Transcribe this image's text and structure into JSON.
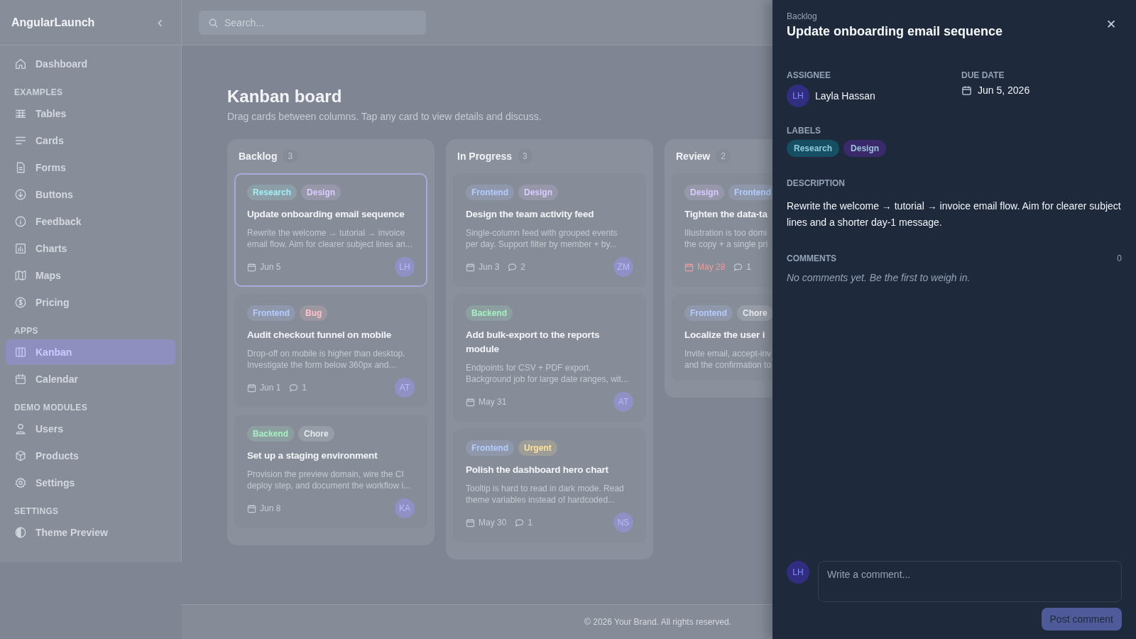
{
  "sidebar": {
    "brand": "AngularLaunch",
    "collapse_icon": "‹",
    "items": [
      {
        "kind": "link",
        "label": "Dashboard",
        "selected": false
      },
      {
        "kind": "section",
        "label": "EXAMPLES"
      },
      {
        "kind": "link",
        "label": "Tables",
        "selected": false
      },
      {
        "kind": "link",
        "label": "Cards",
        "selected": false
      },
      {
        "kind": "link",
        "label": "Forms",
        "selected": false
      },
      {
        "kind": "link",
        "label": "Buttons",
        "selected": false
      },
      {
        "kind": "link",
        "label": "Feedback",
        "selected": false
      },
      {
        "kind": "link",
        "label": "Charts",
        "selected": false
      },
      {
        "kind": "link",
        "label": "Maps",
        "selected": false
      },
      {
        "kind": "link",
        "label": "Pricing",
        "selected": false
      },
      {
        "kind": "section",
        "label": "APPS"
      },
      {
        "kind": "link",
        "label": "Kanban",
        "selected": true
      },
      {
        "kind": "link",
        "label": "Calendar",
        "selected": false
      },
      {
        "kind": "section",
        "label": "DEMO MODULES"
      },
      {
        "kind": "link",
        "label": "Users",
        "selected": false
      },
      {
        "kind": "link",
        "label": "Products",
        "selected": false
      },
      {
        "kind": "link",
        "label": "Settings",
        "selected": false
      },
      {
        "kind": "section",
        "label": "SETTINGS"
      },
      {
        "kind": "link",
        "label": "Theme Preview",
        "selected": false
      }
    ]
  },
  "search": {
    "placeholder": "Search..."
  },
  "page": {
    "title": "Kanban board",
    "subtitle": "Drag cards between columns. Tap any card to view details and discuss."
  },
  "columns": [
    {
      "title": "Backlog",
      "count": "3",
      "cards": [
        {
          "tags": [
            {
              "label": "Research",
              "color": "#a5eef5"
            },
            {
              "label": "Design",
              "color": "#dccbff"
            }
          ],
          "title": "Update onboarding email sequence",
          "desc_lines": [
            "Rewrite the welcome → tutorial → invoice",
            "email flow. Aim for clearer subject lines an..."
          ],
          "due": "Jun 5",
          "overdue": false,
          "assignee": "LH",
          "selected": true
        },
        {
          "tags": [
            {
              "label": "Frontend",
              "color": "#b6ccff"
            },
            {
              "label": "Bug",
              "color": "#ffc2cb"
            }
          ],
          "title": "Audit checkout funnel on mobile",
          "desc_lines": [
            "Drop-off on mobile is higher than desktop.",
            "Investigate the form below 360px and..."
          ],
          "due": "Jun 1",
          "overdue": false,
          "comments": "1",
          "assignee": "AT",
          "selected": false
        },
        {
          "tags": [
            {
              "label": "Backend",
              "color": "#a8f0c4"
            },
            {
              "label": "Chore",
              "color": "#e6e8ed"
            }
          ],
          "title": "Set up a staging environment",
          "desc_lines": [
            "Provision the preview domain, wire the CI",
            "deploy step, and document the workflow i..."
          ],
          "due": "Jun 8",
          "overdue": false,
          "assignee": "KA",
          "selected": false
        }
      ]
    },
    {
      "title": "In Progress",
      "count": "3",
      "cards": [
        {
          "tags": [
            {
              "label": "Frontend",
              "color": "#b6ccff"
            },
            {
              "label": "Design",
              "color": "#dccbff"
            }
          ],
          "title": "Design the team activity feed",
          "desc_lines": [
            "Single-column feed with grouped events",
            "per day. Support filter by member + by..."
          ],
          "due": "Jun 3",
          "overdue": false,
          "comments": "2",
          "assignee": "ZM",
          "selected": false
        },
        {
          "tags": [
            {
              "label": "Backend",
              "color": "#a8f0c4"
            }
          ],
          "title": "Add bulk-export to the reports module",
          "desc_lines": [
            "Endpoints for CSV + PDF export.",
            "Background job for large date ranges, wit..."
          ],
          "due": "May 31",
          "overdue": false,
          "assignee": "AT",
          "selected": false
        },
        {
          "tags": [
            {
              "label": "Frontend",
              "color": "#b6ccff"
            },
            {
              "label": "Urgent",
              "color": "#ffe39c"
            }
          ],
          "title": "Polish the dashboard hero chart",
          "desc_lines": [
            "Tooltip is hard to read in dark mode. Read",
            "theme variables instead of hardcoded..."
          ],
          "due": "May 30",
          "overdue": false,
          "comments": "1",
          "assignee": "NS",
          "selected": false
        }
      ]
    },
    {
      "title": "Review",
      "count": "2",
      "cards": [
        {
          "tags": [
            {
              "label": "Design",
              "color": "#dccbff"
            },
            {
              "label": "Frontend",
              "color": "#b6ccff"
            }
          ],
          "title": "Tighten the data-ta",
          "desc_lines": [
            "Illustration is too domi",
            "the copy + a single pri"
          ],
          "due": "May 28",
          "overdue": true,
          "comments": "1",
          "selected": false
        },
        {
          "tags": [
            {
              "label": "Frontend",
              "color": "#b6ccff"
            },
            {
              "label": "Chore",
              "color": "#e6e8ed"
            }
          ],
          "title": "Localize the user i",
          "desc_lines": [
            "Invite email, accept-inv",
            "and the confirmation to"
          ],
          "selected": false
        }
      ]
    }
  ],
  "footer": "© 2026 Your Brand. All rights reserved.",
  "drawer": {
    "column": "Backlog",
    "title": "Update onboarding email sequence",
    "close_icon": "✕",
    "assignee_label": "ASSIGNEE",
    "assignee_initials": "LH",
    "assignee_name": "Layla Hassan",
    "due_label": "DUE DATE",
    "due": "Jun 5, 2026",
    "labels_label": "LABELS",
    "labels": [
      {
        "label": "Research",
        "color": "#164e63"
      },
      {
        "label": "Design",
        "color": "#3b2a6b"
      }
    ],
    "description_label": "DESCRIPTION",
    "description": "Rewrite the welcome → tutorial → invoice email flow. Aim for clearer subject lines and a shorter day-1 message.",
    "comments_label": "COMMENTS",
    "comments_count": "0",
    "empty_text": "No comments yet. Be the first to weigh in.",
    "commenter_initials": "LH",
    "comment_placeholder": "Write a comment...",
    "post_button": {
      "label": "Post comment",
      "disabled": true
    }
  }
}
